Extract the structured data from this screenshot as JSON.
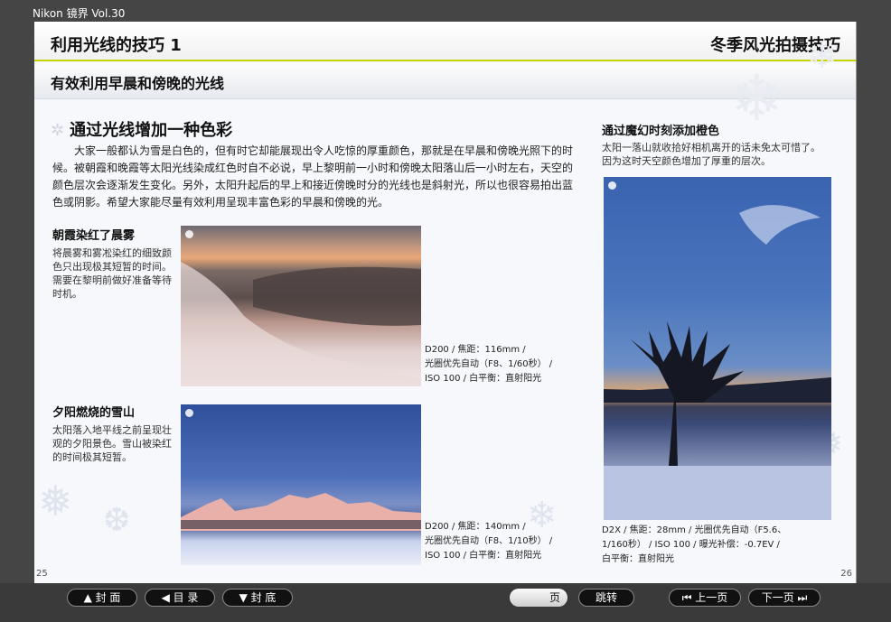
{
  "app": {
    "title": "Nikon 镜界 Vol.30"
  },
  "header": {
    "left": "利用光线的技巧  1",
    "right": "冬季风光拍摄技巧",
    "subtitle": "有效利用早晨和傍晚的光线"
  },
  "section": {
    "title": "通过光线增加一种色彩",
    "intro": "大家一般都认为雪是白色的，但有时它却能展现出令人吃惊的厚重颜色，那就是在早晨和傍晚光照下的时候。被朝霞和晚霞等太阳光线染成红色时自不必说，早上黎明前一小时和傍晚太阳落山后一小时左右，天空的颜色层次会逐渐发生变化。另外，太阳升起后的早上和接近傍晚时分的光线也是斜射光，所以也很容易拍出蓝色或阴影。希望大家能尽量有效利用呈现丰富色彩的早晨和傍晚的光。"
  },
  "items": [
    {
      "title": "朝霞染红了晨雾",
      "desc": "将晨雾和雾凇染红的细致颜色只出现极其短暂的时间。需要在黎明前做好准备等待时机。",
      "caption": [
        "D200 / 焦距：116mm /",
        "光圈优先自动（F8、1/60秒） /",
        "ISO 100 / 白平衡：直射阳光"
      ]
    },
    {
      "title": "夕阳燃烧的雪山",
      "desc": "太阳落入地平线之前呈现壮观的夕阳景色。雪山被染红的时间极其短暂。",
      "caption": [
        "D200 / 焦距：140mm /",
        "光圈优先自动（F8、1/10秒） /",
        "ISO 100 / 白平衡：直射阳光"
      ]
    },
    {
      "title": "通过魔幻时刻添加橙色",
      "desc": "太阳一落山就收拾好相机离开的话未免太可惜了。因为这时天空颜色增加了厚重的层次。",
      "caption": [
        "D2X / 焦距：28mm / 光圈优先自动（F5.6、",
        "1/160秒） / ISO 100 / 曝光补偿：-0.7EV /",
        "白平衡：直射阳光"
      ]
    }
  ],
  "page_numbers": {
    "left": "25",
    "right": "26"
  },
  "nav": {
    "cover": "▲ 封 面",
    "toc": "◀ 目 录",
    "back_cover": "▼ 封 底",
    "page_suffix": "页",
    "jump": "跳转",
    "prev": "⏮ 上一页",
    "next": "下一页 ⏭"
  },
  "colors": {
    "accent": "#c8d400",
    "background": "#454545"
  }
}
